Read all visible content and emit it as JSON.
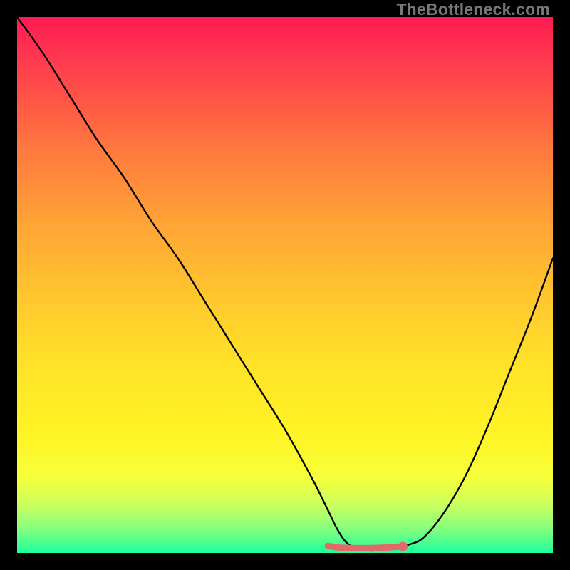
{
  "watermark": "TheBottleneck.com",
  "chart_data": {
    "type": "line",
    "title": "",
    "xlabel": "",
    "ylabel": "",
    "xlim": [
      0,
      100
    ],
    "ylim": [
      0,
      100
    ],
    "series": [
      {
        "name": "bottleneck-curve",
        "x": [
          0,
          5,
          10,
          15,
          20,
          25,
          30,
          35,
          40,
          45,
          50,
          55,
          58,
          60,
          62,
          65,
          68,
          70,
          73,
          76,
          80,
          84,
          88,
          92,
          96,
          100
        ],
        "values": [
          100,
          93,
          85,
          77,
          70,
          62,
          55,
          47,
          39,
          31,
          23,
          14,
          8,
          4,
          1.5,
          0.5,
          0.5,
          0.8,
          1.5,
          3,
          8,
          15,
          24,
          34,
          44,
          55
        ]
      }
    ],
    "optimal_range_x": [
      58,
      72
    ],
    "optimal_marker": {
      "x": 72,
      "y": 1.2
    },
    "flat_segment": {
      "x": [
        58,
        60,
        63,
        66,
        69,
        72
      ],
      "y": [
        1.3,
        1.0,
        0.9,
        0.9,
        1.0,
        1.2
      ]
    },
    "colors": {
      "curve": "#000000",
      "flat_segment": "#e06a6a",
      "marker": "#e06a6a",
      "gradient_top": "#ff1a53",
      "gradient_bottom": "#1cffa0"
    }
  }
}
